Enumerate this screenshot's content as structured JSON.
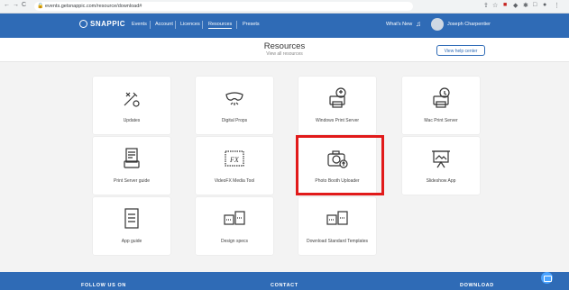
{
  "browser": {
    "back_glyph": "←",
    "forward_glyph": "→",
    "reload_glyph": "C",
    "url": "events.getsnappic.com/resource/download#",
    "extensions": [
      "⇪",
      "☆",
      "■",
      "◆",
      "✱",
      "□",
      "●",
      "⋮"
    ]
  },
  "topnav": {
    "logo": "SNAPPIC",
    "items": [
      "Events",
      "Account",
      "Licences",
      "Resources",
      "Presets"
    ],
    "active_item": "Resources",
    "whats_new": "What's New",
    "user_name": "Joseph Charpentier"
  },
  "page": {
    "title": "Resources",
    "subtitle": "View all resources",
    "help_button": "View help center"
  },
  "resources": [
    {
      "label": "Updates",
      "icon": "tools-icon"
    },
    {
      "label": "Digital Props",
      "icon": "mask-icon"
    },
    {
      "label": "Windows Print Server",
      "icon": "printer-windows-icon"
    },
    {
      "label": "Mac Print Server",
      "icon": "printer-mac-icon"
    },
    {
      "label": "Print Server guide",
      "icon": "document-printer-icon"
    },
    {
      "label": "VideoFX Media Tool",
      "icon": "fx-icon"
    },
    {
      "label": "Photo Booth Uploader",
      "icon": "camera-upload-icon",
      "highlighted": true
    },
    {
      "label": "Slideshow App",
      "icon": "presentation-icon"
    },
    {
      "label": "App guide",
      "icon": "document-icon"
    },
    {
      "label": "Design specs",
      "icon": "dimensions-icon"
    },
    {
      "label": "Download Standard Templates",
      "icon": "templates-icon"
    }
  ],
  "footer": {
    "follow": "FOLLOW US ON",
    "contact": "CONTACT",
    "download": "DOWNLOAD"
  },
  "colors": {
    "brand_blue": "#2f6bb6",
    "highlight_red": "#e11a1a",
    "background": "#f3f3f3"
  }
}
